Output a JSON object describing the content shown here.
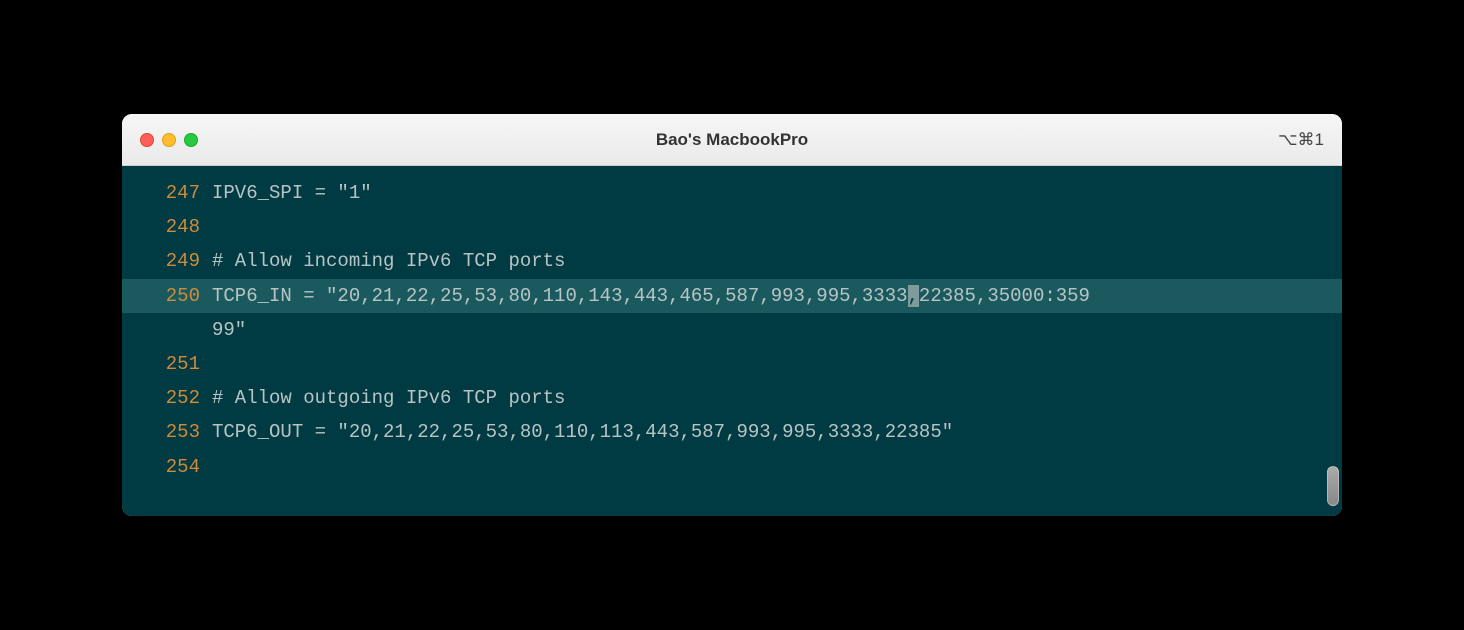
{
  "window": {
    "title": "Bao's MacbookPro",
    "shortcut": "⌥⌘1"
  },
  "editor": {
    "lines": [
      {
        "n": "247",
        "text": "IPV6_SPI = \"1\"",
        "hl": false
      },
      {
        "n": "248",
        "text": "",
        "hl": false
      },
      {
        "n": "249",
        "text": "# Allow incoming IPv6 TCP ports",
        "hl": false
      },
      {
        "n": "250",
        "text_pre": "TCP6_IN = \"20,21,22,25,53,80,110,143,443,465,587,993,995,3333",
        "cursor": ",",
        "text_post": "22385,35000:359",
        "hl": true
      },
      {
        "n": "250c",
        "text": "99\"",
        "hl": false,
        "cont": true
      },
      {
        "n": "251",
        "text": "",
        "hl": false
      },
      {
        "n": "252",
        "text": "# Allow outgoing IPv6 TCP ports",
        "hl": false
      },
      {
        "n": "253",
        "text": "TCP6_OUT = \"20,21,22,25,53,80,110,113,443,587,993,995,3333,22385\"",
        "hl": false
      },
      {
        "n": "254",
        "text": "",
        "hl": false
      }
    ]
  }
}
